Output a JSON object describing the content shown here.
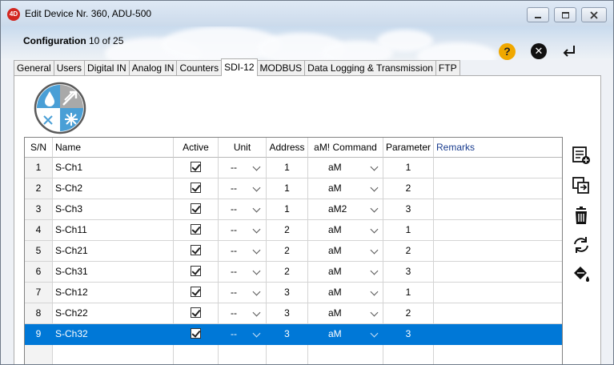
{
  "window": {
    "app_icon": "4D",
    "title": "Edit Device Nr. 360, ADU-500",
    "controls": [
      "minimize-icon",
      "maximize-icon",
      "close-icon"
    ]
  },
  "header": {
    "config_label": "Configuration",
    "config_value": "10 of 25",
    "help_label": "?",
    "cancel_label": "✕",
    "icons": [
      "help-icon",
      "cancel-icon",
      "enter-icon"
    ]
  },
  "tabs": [
    {
      "label": "General"
    },
    {
      "label": "Users"
    },
    {
      "label": "Digital IN"
    },
    {
      "label": "Analog IN"
    },
    {
      "label": "Counters"
    },
    {
      "label": "SDI-12",
      "active": true
    },
    {
      "label": "MODBUS"
    },
    {
      "label": "Data Logging & Transmission"
    },
    {
      "label": "FTP"
    }
  ],
  "table": {
    "columns": [
      "S/N",
      "Name",
      "Active",
      "Unit",
      "Address",
      "aM! Command",
      "Parameter",
      "Remarks"
    ],
    "rows": [
      {
        "sn": "1",
        "name": "S-Ch1",
        "active": true,
        "unit": "--",
        "address": "1",
        "command": "aM",
        "parameter": "1",
        "remarks": ""
      },
      {
        "sn": "2",
        "name": "S-Ch2",
        "active": true,
        "unit": "--",
        "address": "1",
        "command": "aM",
        "parameter": "2",
        "remarks": ""
      },
      {
        "sn": "3",
        "name": "S-Ch3",
        "active": true,
        "unit": "--",
        "address": "1",
        "command": "aM2",
        "parameter": "3",
        "remarks": ""
      },
      {
        "sn": "4",
        "name": "S-Ch11",
        "active": true,
        "unit": "--",
        "address": "2",
        "command": "aM",
        "parameter": "1",
        "remarks": ""
      },
      {
        "sn": "5",
        "name": "S-Ch21",
        "active": true,
        "unit": "--",
        "address": "2",
        "command": "aM",
        "parameter": "2",
        "remarks": ""
      },
      {
        "sn": "6",
        "name": "S-Ch31",
        "active": true,
        "unit": "--",
        "address": "2",
        "command": "aM",
        "parameter": "3",
        "remarks": ""
      },
      {
        "sn": "7",
        "name": "S-Ch12",
        "active": true,
        "unit": "--",
        "address": "3",
        "command": "aM",
        "parameter": "1",
        "remarks": ""
      },
      {
        "sn": "8",
        "name": "S-Ch22",
        "active": true,
        "unit": "--",
        "address": "3",
        "command": "aM",
        "parameter": "2",
        "remarks": ""
      },
      {
        "sn": "9",
        "name": "S-Ch32",
        "active": true,
        "unit": "--",
        "address": "3",
        "command": "aM",
        "parameter": "3",
        "remarks": "",
        "selected": true
      },
      {
        "sn": "",
        "name": "",
        "active": false,
        "unit": "",
        "address": "",
        "command": "",
        "parameter": "",
        "remarks": ""
      }
    ]
  },
  "side_toolbar": [
    "add-row-icon",
    "duplicate-icon",
    "delete-icon",
    "refresh-icon",
    "fill-icon"
  ],
  "colors": {
    "selection": "#0078d7",
    "help": "#f0a800",
    "logo_blue": "#4a9fd6",
    "logo_gray": "#a9a9a9",
    "app_icon": "#d2261f"
  }
}
